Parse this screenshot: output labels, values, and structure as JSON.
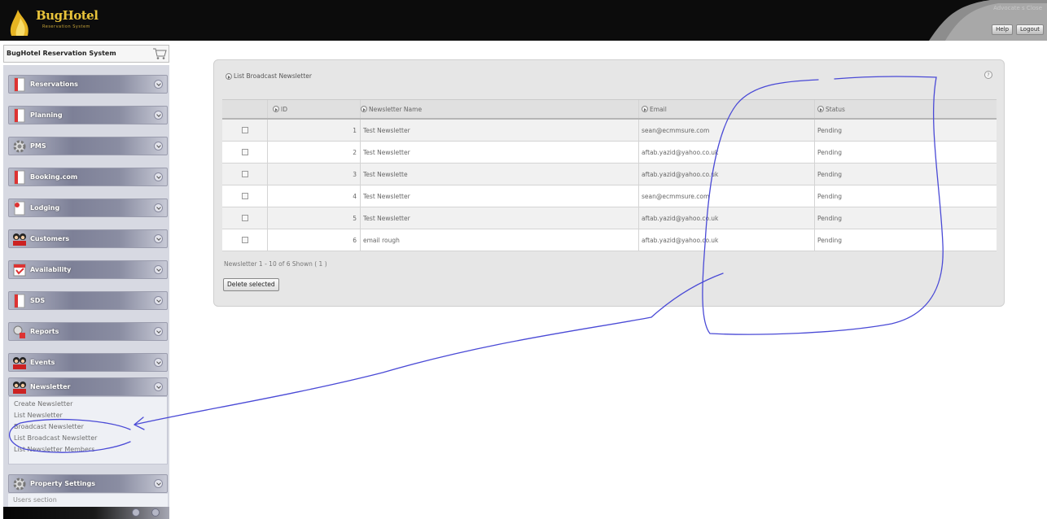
{
  "header": {
    "logo_title": "BugHotel",
    "logo_sub": "Reservation System",
    "user_text": "Advocate s Close",
    "buttons": [
      "Help",
      "Logout"
    ]
  },
  "system_bar": {
    "title": "BugHotel Reservation System"
  },
  "sidebar": {
    "items": [
      {
        "label": "Reservations",
        "icon": "document-icon"
      },
      {
        "label": "Planning",
        "icon": "document-icon"
      },
      {
        "label": "PMS",
        "icon": "gear-icon"
      },
      {
        "label": "Booking.com",
        "icon": "document-icon"
      },
      {
        "label": "Lodging",
        "icon": "document-icon"
      },
      {
        "label": "Customers",
        "icon": "people-icon"
      },
      {
        "label": "Availability",
        "icon": "calendar-icon"
      },
      {
        "label": "SDS",
        "icon": "document-icon"
      },
      {
        "label": "Reports",
        "icon": "reports-icon"
      },
      {
        "label": "Events",
        "icon": "people-icon"
      },
      {
        "label": "Newsletter",
        "icon": "people-icon"
      },
      {
        "label": "Property Settings",
        "icon": "gear-icon"
      }
    ],
    "newsletter_submenu": [
      "Create Newsletter",
      "List Newsletter",
      "Broadcast Newsletter",
      "List Broadcast Newsletter",
      "List Newsletter Members"
    ],
    "property_submenu": [
      "Users section"
    ]
  },
  "panel": {
    "title": "List Broadcast Newsletter",
    "help": "?",
    "columns": [
      "ID",
      "Newsletter Name",
      "Email",
      "Status"
    ],
    "rows": [
      {
        "id": "1",
        "name": "Test Newsletter",
        "email": "sean@ecmmsure.com",
        "status": "Pending"
      },
      {
        "id": "2",
        "name": "Test Newsletter",
        "email": "aftab.yazid@yahoo.co.uk",
        "status": "Pending"
      },
      {
        "id": "3",
        "name": "Test Newslette",
        "email": "aftab.yazid@yahoo.co.uk",
        "status": "Pending"
      },
      {
        "id": "4",
        "name": "Test Newsletter",
        "email": "sean@ecmmsure.com",
        "status": "Pending"
      },
      {
        "id": "5",
        "name": "Test Newsletter",
        "email": "aftab.yazid@yahoo.co.uk",
        "status": "Pending"
      },
      {
        "id": "6",
        "name": "email rough",
        "email": "aftab.yazid@yahoo.co.uk",
        "status": "Pending"
      }
    ],
    "pager": "Newsletter 1 - 10 of 6 Shown ( 1 )",
    "delete_button": "Delete selected"
  },
  "colors": {
    "header_bg": "#0c0c0c",
    "logo_gold": "#e8c33a",
    "sidebar_bg": "#d7d9e2",
    "panel_bg": "#e6e6e6",
    "annotation": "#4a4ad6"
  }
}
